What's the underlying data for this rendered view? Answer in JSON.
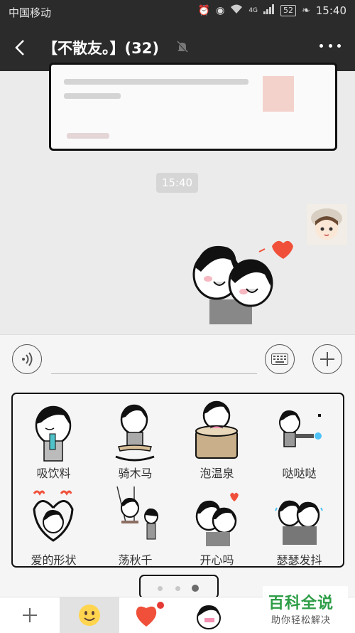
{
  "status_bar": {
    "carrier": "中国移动",
    "network": "4G",
    "battery": "52",
    "time": "15:40"
  },
  "header": {
    "title": "【不散友。】(32)"
  },
  "chat": {
    "timestamp": "15:40"
  },
  "sticker_panel": {
    "items": [
      {
        "label": "吸饮料",
        "icon": "sipping-drink-sticker"
      },
      {
        "label": "骑木马",
        "icon": "rocking-horse-sticker"
      },
      {
        "label": "泡温泉",
        "icon": "hot-spring-sticker"
      },
      {
        "label": "哒哒哒",
        "icon": "shooting-sticker"
      },
      {
        "label": "爱的形状",
        "icon": "heart-shape-sticker"
      },
      {
        "label": "荡秋千",
        "icon": "swing-sticker"
      },
      {
        "label": "开心吗",
        "icon": "hug-sticker"
      },
      {
        "label": "瑟瑟发抖",
        "icon": "shivering-sticker"
      }
    ],
    "page_count": 3,
    "active_page": 3
  },
  "tab_bar": {
    "tabs": [
      "add-icon",
      "emoji-icon",
      "heart-icon",
      "sticker-pack-icon"
    ],
    "selected": 1
  },
  "watermark": {
    "title": "百科全说",
    "subtitle": "助你轻松解决"
  },
  "colors": {
    "header_bg": "#2b2b2b",
    "heart": "#f0503a",
    "watermark_green": "#2e9d46"
  }
}
